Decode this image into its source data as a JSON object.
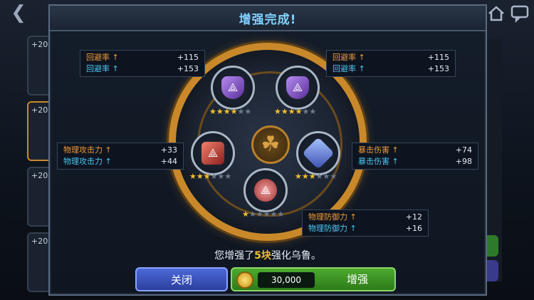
{
  "header": {
    "title": "增强完成!"
  },
  "side_slots": [
    "+20",
    "+20",
    "+20",
    "+20"
  ],
  "runes": [
    {
      "id": "top-left",
      "color": "purple",
      "stars_on": 4,
      "stars_total": 6
    },
    {
      "id": "top-right",
      "color": "purple",
      "stars_on": 4,
      "stars_total": 6
    },
    {
      "id": "mid-left",
      "color": "red",
      "stars_on": 3,
      "stars_total": 6
    },
    {
      "id": "mid-right",
      "color": "blue",
      "stars_on": 3,
      "stars_total": 6
    },
    {
      "id": "bottom",
      "color": "pink",
      "stars_on": 1,
      "stars_total": 6
    }
  ],
  "stats": {
    "top_left": {
      "old_name": "回避率",
      "old_val": "+115",
      "new_name": "回避率",
      "new_val": "+153"
    },
    "top_right": {
      "old_name": "回避率",
      "old_val": "+115",
      "new_name": "回避率",
      "new_val": "+153"
    },
    "mid_left": {
      "old_name": "物理攻击力",
      "old_val": "+33",
      "new_name": "物理攻击力",
      "new_val": "+44"
    },
    "mid_right": {
      "old_name": "暴击伤害",
      "old_val": "+74",
      "new_name": "暴击伤害",
      "new_val": "+98"
    },
    "bottom": {
      "old_name": "物理防御力",
      "old_val": "+12",
      "new_name": "物理防御力",
      "new_val": "+16"
    }
  },
  "summary": {
    "prefix": "您增强了",
    "count": "5块",
    "suffix": "强化乌鲁。"
  },
  "buttons": {
    "close": "关闭",
    "enhance": "增强",
    "cost": "30,000"
  },
  "colors": {
    "accent": "#7fd2ff",
    "gold": "#c9892b",
    "old_stat": "#f09a3a",
    "new_stat": "#4ec6f0"
  }
}
